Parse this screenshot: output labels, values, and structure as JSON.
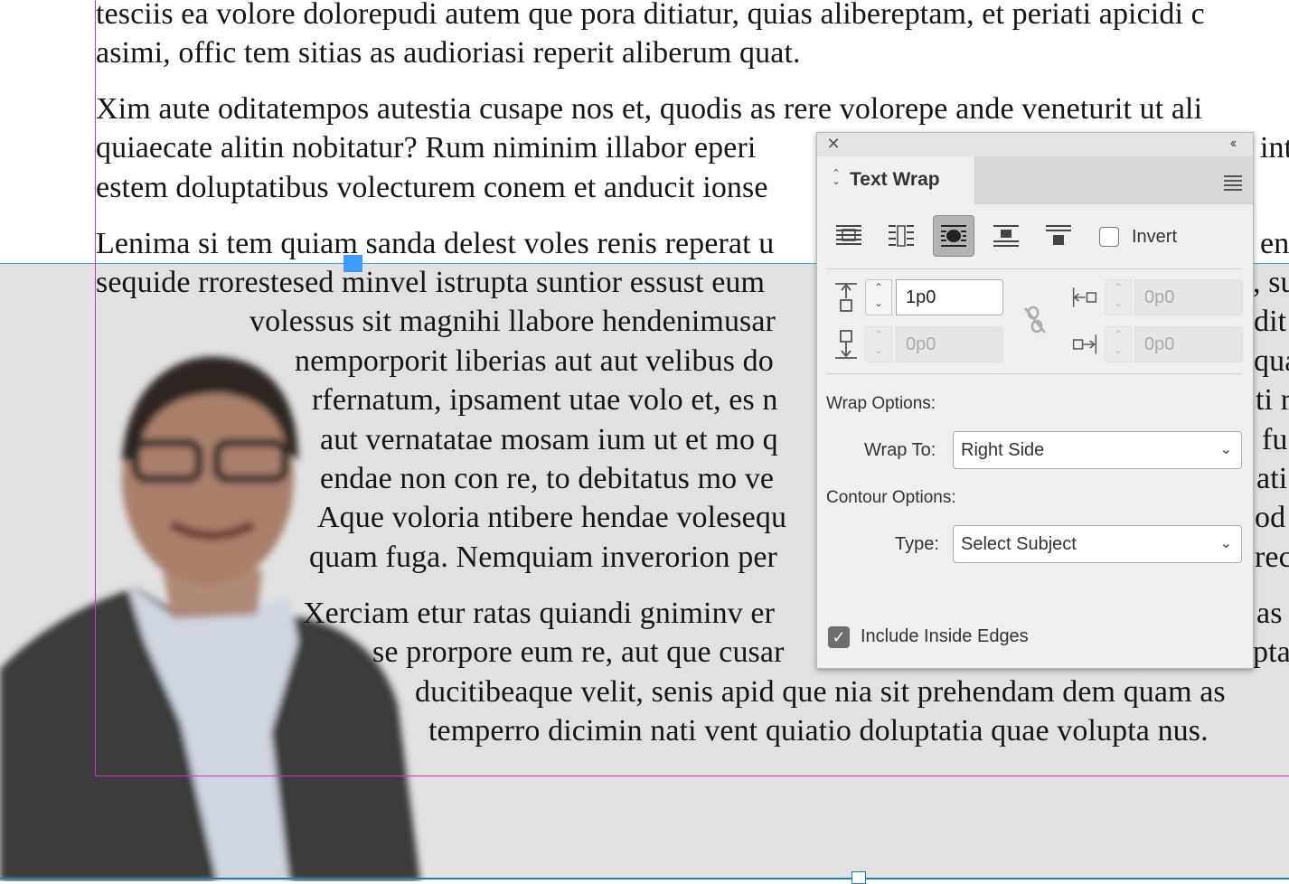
{
  "document": {
    "lines": [
      "tesciis ea volore dolorepudi autem que pora ditiatur, quias alibereptam, et periati apicidi c",
      "asimi, offic tem sitias as audioriasi reperit aliberum quat.",
      "Xim aute oditatempos autestia cusape nos et, quodis as rere volorepe ande veneturit ut ali",
      "quiaecate alitin nobitatur? Rum niminim illabor eperi",
      "estem doluptatibus volecturem conem et anducit ionse",
      "Lenima si tem quiam sanda delest voles renis reperat u",
      "sequide rrorestesed minvel istrupta suntior essust eum",
      "volessus sit magnihi llabore hendenimusar",
      "nemporporit liberias aut aut velibus do",
      "rfernatum, ipsament utae volo et, es n",
      "aut vernatatae mosam ium ut et mo q",
      "endae non con re, to debitatus mo ve",
      "Aque voloria ntibere hendae volesequ",
      "quam fuga. Nemquiam inverorion per",
      "Xerciam etur ratas quiandi gniminv er",
      "se prorpore eum re, aut que cusar",
      "ducitibeaque velit, senis apid que nia sit prehendam dem quam as",
      "temperro dicimin nati vent quiatio doluptatia quae volupta nus."
    ],
    "right_fragments": [
      "int",
      "ent",
      ", su",
      "dit",
      "qua",
      "ti r",
      "fu",
      "ati",
      "od",
      "rec",
      "as",
      "ptas"
    ]
  },
  "panel": {
    "title": "Text Wrap",
    "invert_label": "Invert",
    "top_offset": "1p0",
    "bottom_offset": "0p0",
    "left_offset": "0p0",
    "right_offset": "0p0",
    "wrap_options_label": "Wrap Options:",
    "wrap_to_label": "Wrap To:",
    "wrap_to_value": "Right Side",
    "contour_options_label": "Contour Options:",
    "type_label": "Type:",
    "type_value": "Select Subject",
    "include_inside_edges_label": "Include Inside Edges",
    "include_inside_edges_checked": true,
    "invert_checked": false,
    "active_wrap_mode": "wrap-around-object-shape"
  }
}
